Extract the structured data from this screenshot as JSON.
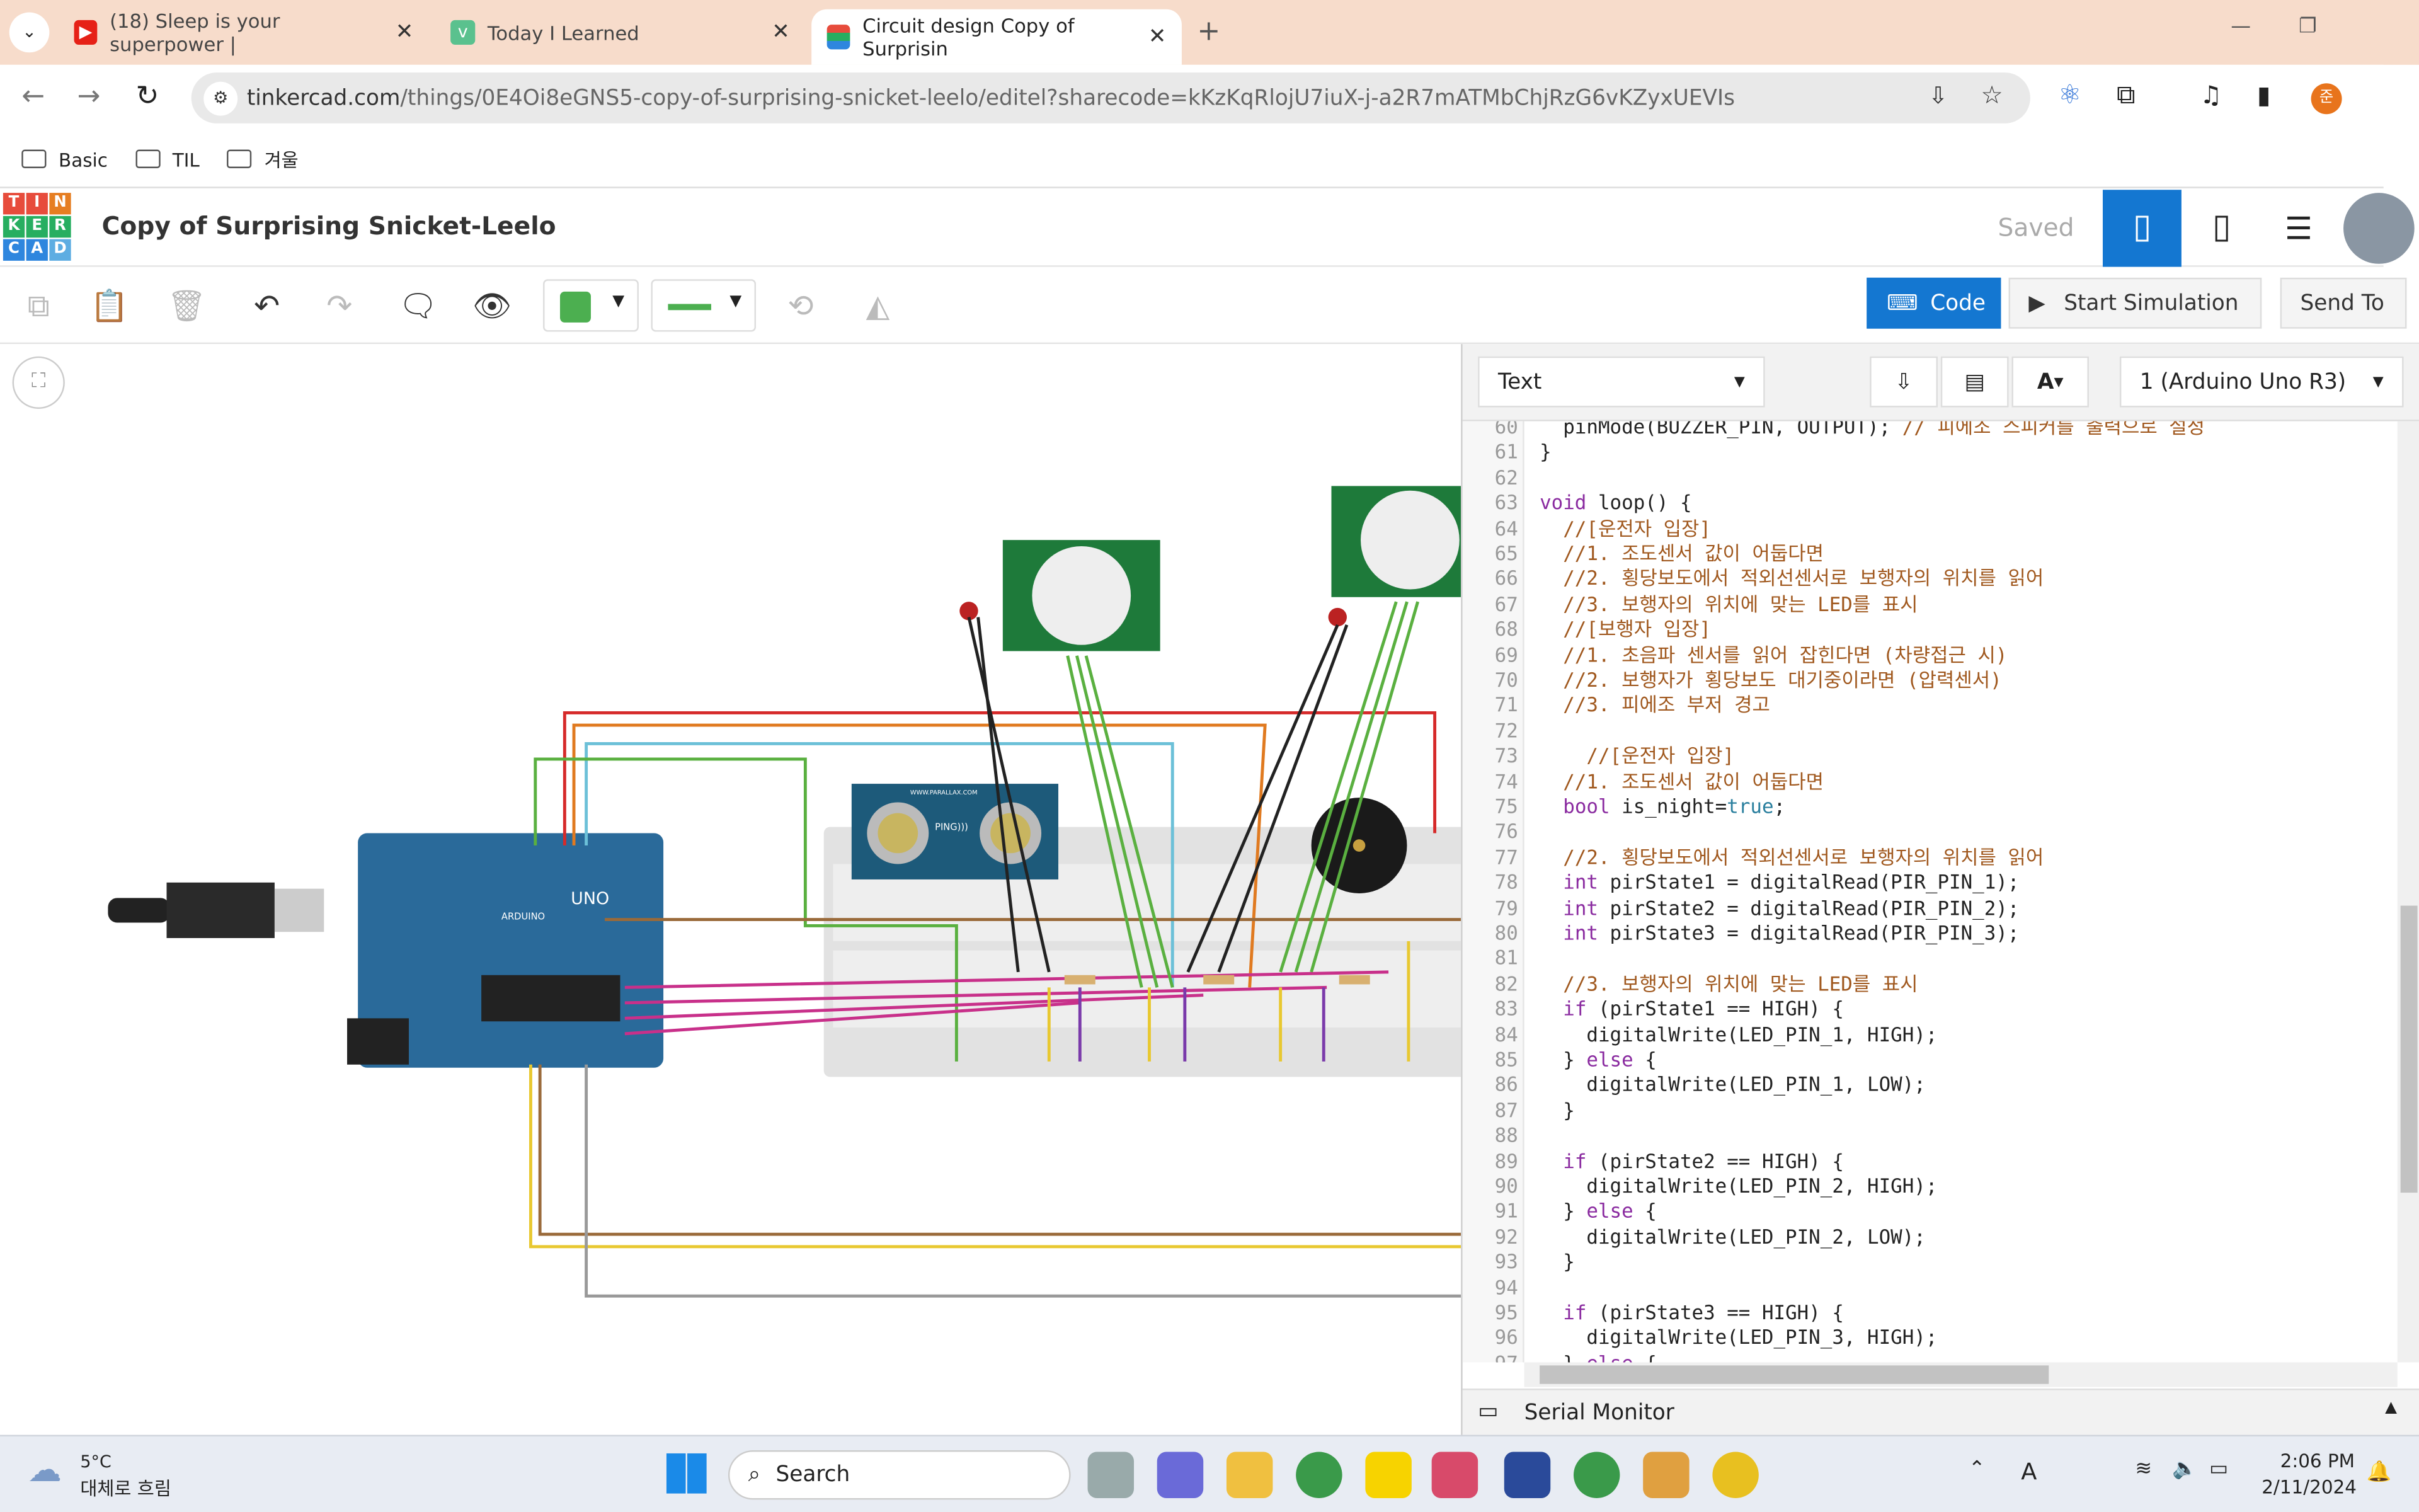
{
  "browser": {
    "tabs": [
      {
        "title": "(18) Sleep is your superpower |",
        "icon": "youtube-icon",
        "color": "#e62117"
      },
      {
        "title": "Today I Learned",
        "icon": "velog-icon",
        "color": "#5ac18e"
      },
      {
        "title": "Circuit design Copy of Surprisin",
        "icon": "tinkercad-icon",
        "active": true
      }
    ],
    "url_host": "tinkercad.com",
    "url_path": "/things/0E4Oi8eGNS5-copy-of-surprising-snicket-leelo/editel?sharecode=kKzKqRlojU7iuX-j-a2R7mATMbChjRzG6vKZyxUEVIs",
    "bookmarks": [
      "Basic",
      "TIL",
      "겨울"
    ],
    "profile_initial": "준"
  },
  "app": {
    "logo_letters": [
      "T",
      "I",
      "N",
      "K",
      "E",
      "R",
      "C",
      "A",
      "D"
    ],
    "title": "Copy of Surprising Snicket-Leelo",
    "status": "Saved",
    "accent": "#1477d1"
  },
  "toolbar": {
    "code_label": "Code",
    "simulate_label": "Start Simulation",
    "send_label": "Send To",
    "fill_color": "#4caf50",
    "wire_color": "#4caf50"
  },
  "code_panel": {
    "mode": "Text",
    "board": "1 (Arduino Uno R3)",
    "serial_monitor": "Serial Monitor",
    "lines": [
      {
        "n": "60",
        "s": [
          [
            "  pinMode(BUZZER_PIN, OUTPUT); ",
            ""
          ],
          [
            "// 피에조 스피커를 출력으로 설정",
            "cm"
          ]
        ]
      },
      {
        "n": "61",
        "s": [
          [
            "}",
            ""
          ]
        ]
      },
      {
        "n": "62",
        "s": []
      },
      {
        "n": "63",
        "s": [
          [
            "void",
            "kw"
          ],
          [
            " loop() {",
            ""
          ]
        ]
      },
      {
        "n": "64",
        "s": [
          [
            "  //[운전자 입장]",
            "cm"
          ]
        ]
      },
      {
        "n": "65",
        "s": [
          [
            "  //1. 조도센서 값이 어둡다면",
            "cm"
          ]
        ]
      },
      {
        "n": "66",
        "s": [
          [
            "  //2. 횡당보도에서 적외선센서로 보행자의 위치를 읽어",
            "cm"
          ]
        ]
      },
      {
        "n": "67",
        "s": [
          [
            "  //3. 보행자의 위치에 맞는 LED를 표시",
            "cm"
          ]
        ]
      },
      {
        "n": "68",
        "s": [
          [
            "  //[보행자 입장]",
            "cm"
          ]
        ]
      },
      {
        "n": "69",
        "s": [
          [
            "  //1. 초음파 센서를 읽어 잡힌다면 (차량접근 시)",
            "cm"
          ]
        ]
      },
      {
        "n": "70",
        "s": [
          [
            "  //2. 보행자가 횡당보도 대기중이라면 (압력센서)",
            "cm"
          ]
        ]
      },
      {
        "n": "71",
        "s": [
          [
            "  //3. 피에조 부저 경고",
            "cm"
          ]
        ]
      },
      {
        "n": "72",
        "s": []
      },
      {
        "n": "73",
        "s": [
          [
            "    //[운전자 입장]",
            "cm"
          ]
        ]
      },
      {
        "n": "74",
        "s": [
          [
            "  //1. 조도센서 값이 어둡다면",
            "cm"
          ]
        ]
      },
      {
        "n": "75",
        "s": [
          [
            "  ",
            ""
          ],
          [
            "bool",
            "kw"
          ],
          [
            " is_night=",
            ""
          ],
          [
            "true",
            "lit"
          ],
          [
            ";",
            ""
          ]
        ]
      },
      {
        "n": "76",
        "s": []
      },
      {
        "n": "77",
        "s": [
          [
            "  //2. 횡당보도에서 적외선센서로 보행자의 위치를 읽어",
            "cm"
          ]
        ]
      },
      {
        "n": "78",
        "s": [
          [
            "  ",
            ""
          ],
          [
            "int",
            "kw"
          ],
          [
            " pirState1 = digitalRead(PIR_PIN_1);",
            ""
          ]
        ]
      },
      {
        "n": "79",
        "s": [
          [
            "  ",
            ""
          ],
          [
            "int",
            "kw"
          ],
          [
            " pirState2 = digitalRead(PIR_PIN_2);",
            ""
          ]
        ]
      },
      {
        "n": "80",
        "s": [
          [
            "  ",
            ""
          ],
          [
            "int",
            "kw"
          ],
          [
            " pirState3 = digitalRead(PIR_PIN_3);",
            ""
          ]
        ]
      },
      {
        "n": "81",
        "s": []
      },
      {
        "n": "82",
        "s": [
          [
            "  //3. 보행자의 위치에 맞는 LED를 표시",
            "cm"
          ]
        ]
      },
      {
        "n": "83",
        "s": [
          [
            "  ",
            ""
          ],
          [
            "if",
            "kw"
          ],
          [
            " (pirState1 == HIGH) {",
            ""
          ]
        ]
      },
      {
        "n": "84",
        "s": [
          [
            "    digitalWrite(LED_PIN_1, HIGH);",
            ""
          ]
        ]
      },
      {
        "n": "85",
        "s": [
          [
            "  } ",
            ""
          ],
          [
            "else",
            "kw"
          ],
          [
            " {",
            ""
          ]
        ]
      },
      {
        "n": "86",
        "s": [
          [
            "    digitalWrite(LED_PIN_1, LOW);",
            ""
          ]
        ]
      },
      {
        "n": "87",
        "s": [
          [
            "  }",
            ""
          ]
        ]
      },
      {
        "n": "88",
        "s": []
      },
      {
        "n": "89",
        "s": [
          [
            "  ",
            ""
          ],
          [
            "if",
            "kw"
          ],
          [
            " (pirState2 == HIGH) {",
            ""
          ]
        ]
      },
      {
        "n": "90",
        "s": [
          [
            "    digitalWrite(LED_PIN_2, HIGH);",
            ""
          ]
        ]
      },
      {
        "n": "91",
        "s": [
          [
            "  } ",
            ""
          ],
          [
            "else",
            "kw"
          ],
          [
            " {",
            ""
          ]
        ]
      },
      {
        "n": "92",
        "s": [
          [
            "    digitalWrite(LED_PIN_2, LOW);",
            ""
          ]
        ]
      },
      {
        "n": "93",
        "s": [
          [
            "  }",
            ""
          ]
        ]
      },
      {
        "n": "94",
        "s": []
      },
      {
        "n": "95",
        "s": [
          [
            "  ",
            ""
          ],
          [
            "if",
            "kw"
          ],
          [
            " (pirState3 == HIGH) {",
            ""
          ]
        ]
      },
      {
        "n": "96",
        "s": [
          [
            "    digitalWrite(LED_PIN_3, HIGH);",
            ""
          ]
        ]
      },
      {
        "n": "97",
        "s": [
          [
            "  } ",
            ""
          ],
          [
            "else",
            "kw"
          ],
          [
            " {",
            ""
          ]
        ]
      }
    ]
  },
  "circuit": {
    "arduino_label": "UNO",
    "arduino_brand": "ARDUINO",
    "ping_label": "PING)))",
    "parallax": "WWW.PARALLAX.COM"
  },
  "taskbar": {
    "weather_temp": "5°C",
    "weather_desc": "대체로 흐림",
    "search_placeholder": "Search",
    "time": "2:06 PM",
    "date": "2/11/2024"
  }
}
